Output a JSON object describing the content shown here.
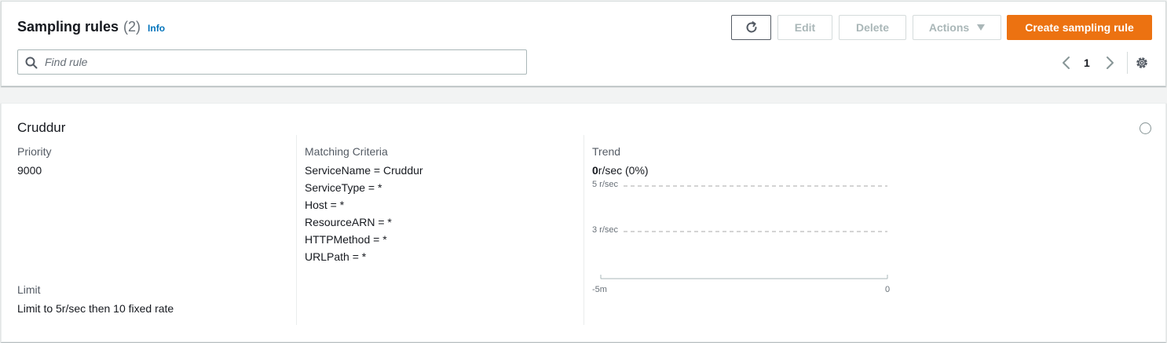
{
  "header": {
    "title": "Sampling rules",
    "count": "(2)",
    "info_link": "Info"
  },
  "toolbar": {
    "edit_label": "Edit",
    "delete_label": "Delete",
    "actions_label": "Actions",
    "create_label": "Create sampling rule"
  },
  "search": {
    "placeholder": "Find rule",
    "value": ""
  },
  "pagination": {
    "current_page": "1"
  },
  "rule": {
    "name": "Cruddur",
    "priority_label": "Priority",
    "priority_value": "9000",
    "limit_label": "Limit",
    "limit_value": "Limit to 5r/sec then 10 fixed rate",
    "criteria_label": "Matching Criteria",
    "criteria": [
      "ServiceName = Cruddur",
      "ServiceType = *",
      "Host = *",
      "ResourceARN = *",
      "HTTPMethod = *",
      "URLPath = *"
    ],
    "trend_label": "Trend",
    "trend_rate_bold": "0",
    "trend_rate_rest": "r/sec (0%)"
  },
  "chart_data": {
    "type": "line",
    "y_ticks": [
      "5 r/sec",
      "3 r/sec"
    ],
    "x_ticks": [
      "-5m",
      "0"
    ],
    "series": []
  },
  "colors": {
    "primary_button": "#ec7211",
    "link": "#0073bb",
    "text": "#16191f",
    "muted_text": "#545b64"
  }
}
